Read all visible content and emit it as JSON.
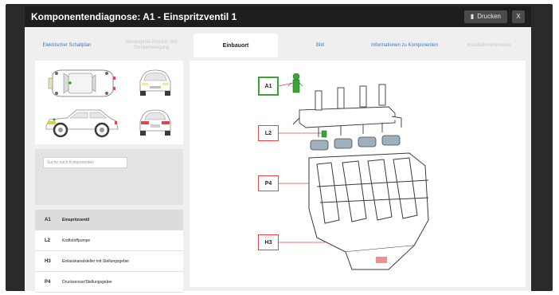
{
  "window": {
    "title": "Komponentendiagnose: A1 - Einspritzventil 1",
    "print_label": "Drucken",
    "close_label": "X"
  },
  "tabs": [
    {
      "label": "Elektrischer Schaltplan",
      "state": "enabled"
    },
    {
      "label": "Steuergerät-Stecker und Steckerbelegung",
      "state": "disabled"
    },
    {
      "label": "Einbauort",
      "state": "active"
    },
    {
      "label": "Bild",
      "state": "enabled"
    },
    {
      "label": "Informationen zu Komponenten",
      "state": "enabled"
    },
    {
      "label": "Installationshinweise",
      "state": "disabled"
    }
  ],
  "search": {
    "placeholder": "Suche nach Komponenten"
  },
  "components": [
    {
      "code": "A1",
      "name": "Einspritzventil",
      "selected": true
    },
    {
      "code": "L2",
      "name": "Kraftstoffpumpe",
      "selected": false
    },
    {
      "code": "H3",
      "name": "Einlasskanalsteller mit Stellungsgeber",
      "selected": false
    },
    {
      "code": "P4",
      "name": "Drucksensor/Stellungsgeber",
      "selected": false
    }
  ],
  "diagram_labels": [
    {
      "code": "A1",
      "highlight": true
    },
    {
      "code": "L2",
      "highlight": false
    },
    {
      "code": "P4",
      "highlight": false
    },
    {
      "code": "H3",
      "highlight": false
    }
  ],
  "colors": {
    "highlight": "#3aa33a",
    "callout": "#d94a4a",
    "link": "#2f7bd1"
  }
}
